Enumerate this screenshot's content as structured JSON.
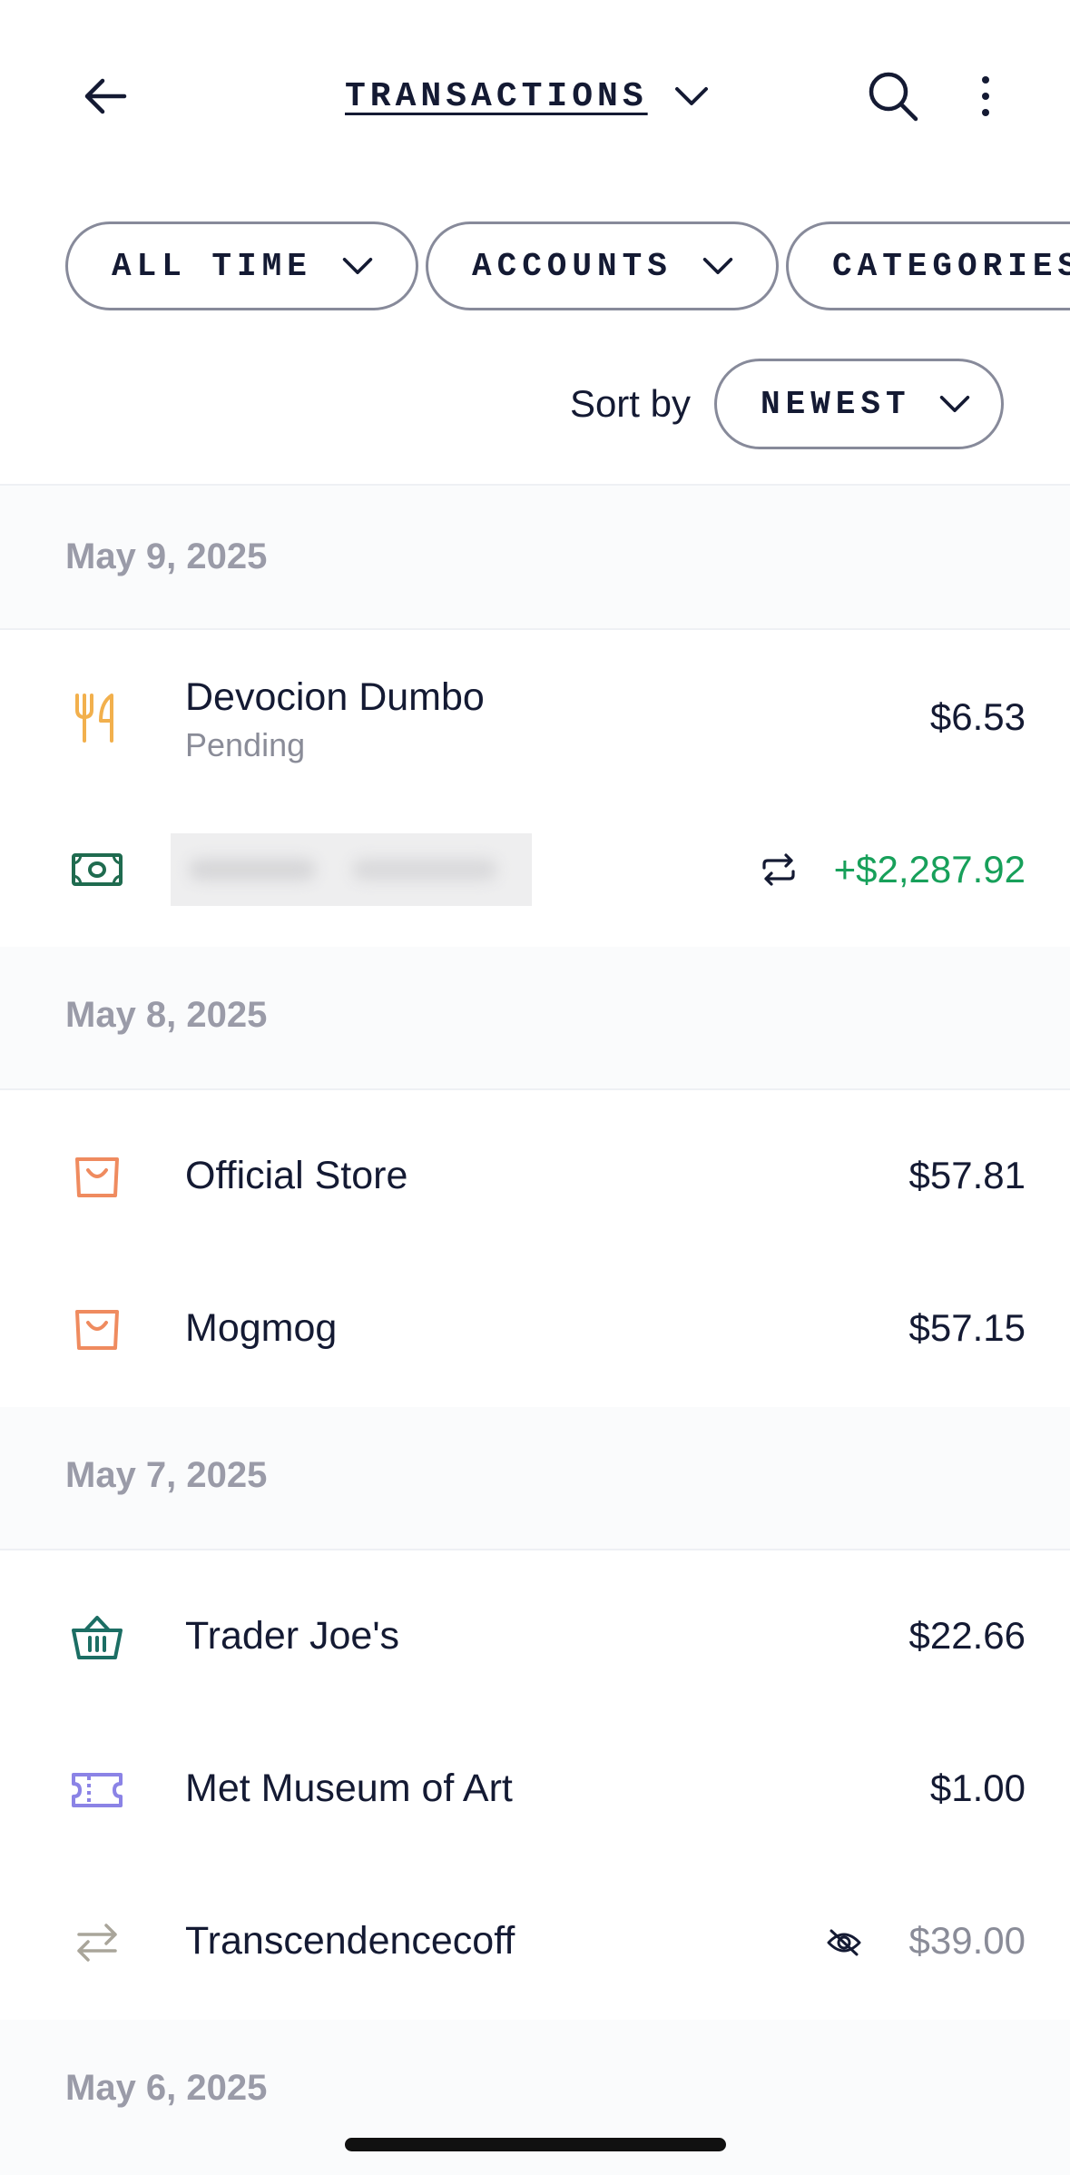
{
  "header": {
    "title": "TRANSACTIONS",
    "back_icon": "arrow-left-icon",
    "title_chevron_icon": "chevron-down-icon",
    "search_icon": "search-icon",
    "more_icon": "more-vertical-icon"
  },
  "filters": {
    "chips": [
      {
        "label": "ALL TIME"
      },
      {
        "label": "ACCOUNTS"
      },
      {
        "label": "CATEGORIES"
      }
    ]
  },
  "sort": {
    "label": "Sort by",
    "value": "NEWEST"
  },
  "groups": [
    {
      "date": "May 9, 2025",
      "transactions": [
        {
          "name": "Devocion Dumbo",
          "status": "Pending",
          "amount": "$6.53",
          "icon": "fork-knife-icon",
          "icon_color": "#f2b04d"
        },
        {
          "name": "",
          "amount": "+$2,287.92",
          "icon": "cash-icon",
          "icon_color": "#1f6b4f",
          "amount_color": "#17a05a",
          "indicator_icon": "recurring-icon"
        }
      ]
    },
    {
      "date": "May 8, 2025",
      "transactions": [
        {
          "name": "Official Store",
          "amount": "$57.81",
          "icon": "shopping-bag-icon",
          "icon_color": "#ef8b5f"
        },
        {
          "name": "Mogmog",
          "amount": "$57.15",
          "icon": "shopping-bag-icon",
          "icon_color": "#ef8b5f"
        }
      ]
    },
    {
      "date": "May 7, 2025",
      "transactions": [
        {
          "name": "Trader Joe's",
          "amount": "$22.66",
          "icon": "basket-icon",
          "icon_color": "#1c6e64"
        },
        {
          "name": "Met Museum of Art",
          "amount": "$1.00",
          "icon": "ticket-icon",
          "icon_color": "#8b83e6"
        },
        {
          "name": "Transcendencecoff",
          "amount": "$39.00",
          "icon": "transfer-arrows-icon",
          "icon_color": "#a9a59a",
          "amount_color": "#8a8c98",
          "indicator_icon": "eye-off-icon"
        }
      ]
    },
    {
      "date": "May 6, 2025",
      "transactions": []
    }
  ]
}
